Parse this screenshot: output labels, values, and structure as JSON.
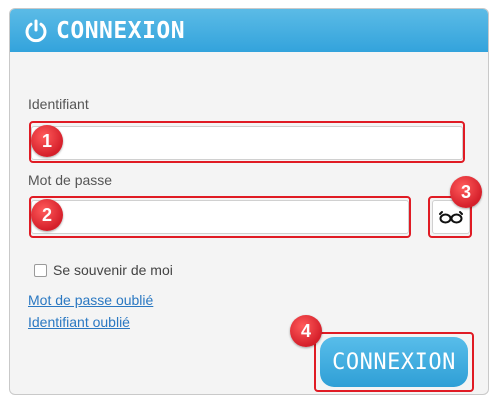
{
  "header": {
    "title": "CONNEXION",
    "icon": "power-icon"
  },
  "form": {
    "username_label": "Identifiant",
    "username_value": "",
    "password_label": "Mot de passe",
    "password_value": "",
    "show_password_icon": "glasses-icon",
    "remember_label": "Se souvenir de moi",
    "remember_checked": false,
    "forgot_password_link": "Mot de passe oublié",
    "forgot_username_link": "Identifiant oublié",
    "submit_label": "CONNEXION"
  },
  "annotations": [
    "1",
    "2",
    "3",
    "4"
  ],
  "colors": {
    "accent": "#33a3dc",
    "highlight": "#e01b24",
    "link": "#2a78c2"
  }
}
